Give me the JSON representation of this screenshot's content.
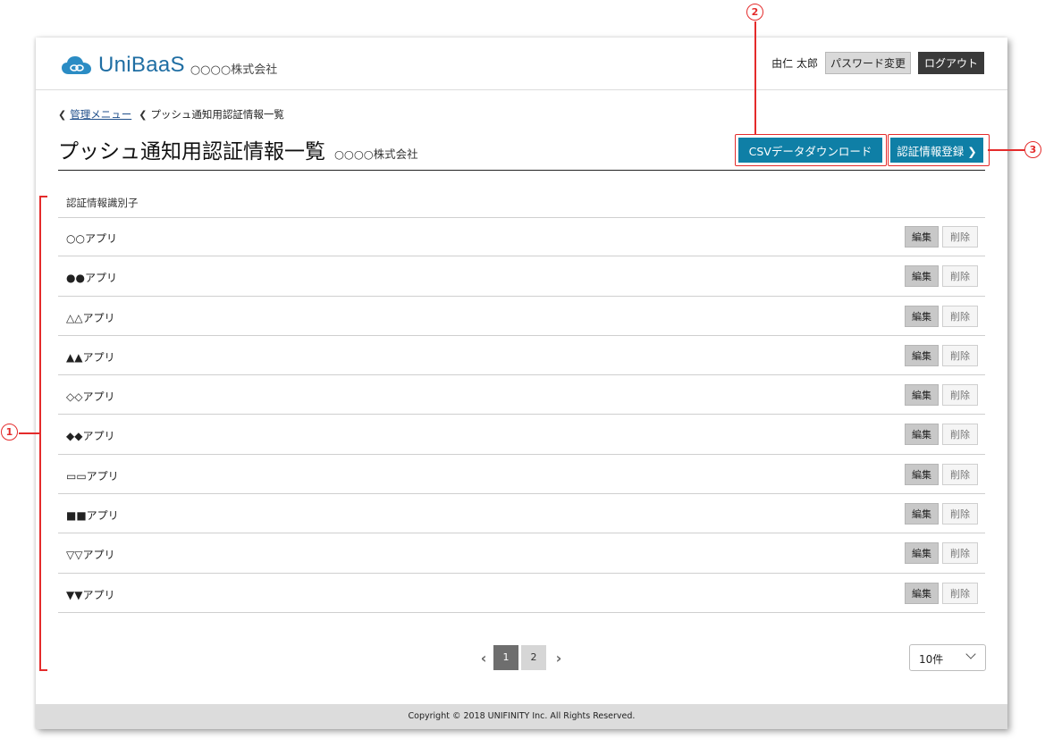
{
  "header": {
    "logo_text": "UniBaaS",
    "company": "○○○○株式会社",
    "user_name": "由仁 太郎",
    "password_button": "パスワード変更",
    "logout_button": "ログアウト"
  },
  "breadcrumb": {
    "link": "管理メニュー",
    "current": "プッシュ通知用認証情報一覧"
  },
  "page": {
    "title": "プッシュ通知用認証情報一覧",
    "company": "○○○○株式会社",
    "csv_button": "CSVデータダウンロード",
    "register_button": "認証情報登録 ❯"
  },
  "table": {
    "column_header": "認証情報識別子",
    "edit_label": "編集",
    "delete_label": "削除",
    "rows": [
      "○○アプリ",
      "●●アプリ",
      "△△アプリ",
      "▲▲アプリ",
      "◇◇アプリ",
      "◆◆アプリ",
      "▭▭アプリ",
      "■■アプリ",
      "▽▽アプリ",
      "▼▼アプリ"
    ]
  },
  "pagination": {
    "prev": "‹",
    "next": "›",
    "pages": [
      "1",
      "2"
    ],
    "current_page": "1",
    "per_page": "10件"
  },
  "footer": {
    "copyright": "Copyright © 2018 UNIFINITY Inc. All Rights Reserved."
  },
  "annotations": {
    "one": "1",
    "two": "2",
    "three": "3",
    "color": "#e42b2b"
  },
  "colors": {
    "brand_blue": "#1f6ea3",
    "button_teal": "#0f7fa6"
  }
}
